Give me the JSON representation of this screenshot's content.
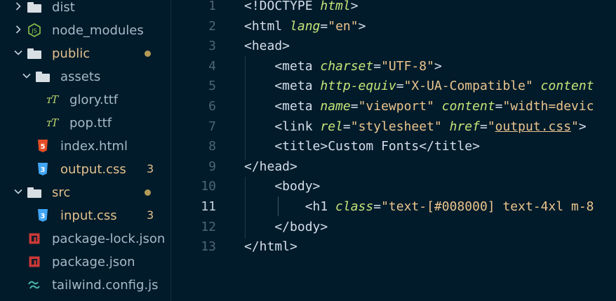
{
  "explorer": {
    "items": [
      {
        "label": "dist",
        "type": "folder",
        "expanded": false,
        "color": "#a7b9c7"
      },
      {
        "label": "node_modules",
        "type": "folder",
        "icon": "nodejs-folder-icon",
        "expanded": false,
        "color": "#a7b9c7"
      },
      {
        "label": "public",
        "type": "folder",
        "expanded": true,
        "color": "#e2c08d",
        "modified": true
      },
      {
        "label": "assets",
        "type": "folder",
        "expanded": true,
        "color": "#a7b9c7"
      },
      {
        "label": "glory.ttf",
        "type": "font",
        "color": "#a7b9c7"
      },
      {
        "label": "pop.ttf",
        "type": "font",
        "color": "#a7b9c7"
      },
      {
        "label": "index.html",
        "type": "html",
        "color": "#a7b9c7"
      },
      {
        "label": "output.css",
        "type": "css",
        "color": "#e2c08d",
        "badge": "3"
      },
      {
        "label": "src",
        "type": "folder",
        "expanded": true,
        "color": "#e2c08d",
        "modified": true
      },
      {
        "label": "input.css",
        "type": "css",
        "color": "#e2c08d",
        "badge": "3"
      },
      {
        "label": "package-lock.json",
        "type": "json",
        "color": "#a7b9c7"
      },
      {
        "label": "package.json",
        "type": "json",
        "color": "#a7b9c7"
      },
      {
        "label": "tailwind.config.js",
        "type": "tailwind",
        "color": "#a7b9c7"
      }
    ]
  },
  "editor": {
    "active_line": "11",
    "line_numbers": [
      "1",
      "2",
      "3",
      "4",
      "5",
      "6",
      "7",
      "8",
      "9",
      "10",
      "11",
      "12",
      "13"
    ],
    "lines": [
      [
        {
          "t": "<!DOCTYPE ",
          "c": "tag"
        },
        {
          "t": "html",
          "c": "attr"
        },
        {
          "t": ">",
          "c": "tag"
        }
      ],
      [
        {
          "t": "<html ",
          "c": "tag"
        },
        {
          "t": "lang",
          "c": "attr"
        },
        {
          "t": "=",
          "c": "punct"
        },
        {
          "t": "\"en\"",
          "c": "str"
        },
        {
          "t": ">",
          "c": "tag"
        }
      ],
      [
        {
          "t": "<head>",
          "c": "tag"
        }
      ],
      [
        {
          "t": "    <meta ",
          "c": "tag"
        },
        {
          "t": "charset",
          "c": "attr"
        },
        {
          "t": "=",
          "c": "punct"
        },
        {
          "t": "\"UTF-8\"",
          "c": "str"
        },
        {
          "t": ">",
          "c": "tag"
        }
      ],
      [
        {
          "t": "    <meta ",
          "c": "tag"
        },
        {
          "t": "http-equiv",
          "c": "attr"
        },
        {
          "t": "=",
          "c": "punct"
        },
        {
          "t": "\"X-UA-Compatible\" ",
          "c": "str"
        },
        {
          "t": "content",
          "c": "attr"
        }
      ],
      [
        {
          "t": "    <meta ",
          "c": "tag"
        },
        {
          "t": "name",
          "c": "attr"
        },
        {
          "t": "=",
          "c": "punct"
        },
        {
          "t": "\"viewport\" ",
          "c": "str"
        },
        {
          "t": "content",
          "c": "attr"
        },
        {
          "t": "=",
          "c": "punct"
        },
        {
          "t": "\"width=devic",
          "c": "str"
        }
      ],
      [
        {
          "t": "    <link ",
          "c": "tag"
        },
        {
          "t": "rel",
          "c": "attr"
        },
        {
          "t": "=",
          "c": "punct"
        },
        {
          "t": "\"stylesheet\" ",
          "c": "str"
        },
        {
          "t": "href",
          "c": "attr"
        },
        {
          "t": "=",
          "c": "punct"
        },
        {
          "t": "\"",
          "c": "str"
        },
        {
          "t": "output.css",
          "c": "str-u"
        },
        {
          "t": "\"",
          "c": "str"
        },
        {
          "t": ">",
          "c": "tag"
        }
      ],
      [
        {
          "t": "    <title>",
          "c": "tag"
        },
        {
          "t": "Custom Fonts",
          "c": "punct"
        },
        {
          "t": "</title>",
          "c": "tag"
        }
      ],
      [
        {
          "t": "</head>",
          "c": "tag"
        }
      ],
      [
        {
          "t": "    <body>",
          "c": "tag"
        }
      ],
      [
        {
          "t": "        <h1 ",
          "c": "tag"
        },
        {
          "t": "class",
          "c": "attr"
        },
        {
          "t": "=",
          "c": "punct"
        },
        {
          "t": "\"text-[#008000] text-4xl m-8",
          "c": "str"
        }
      ],
      [
        {
          "t": "    </body>",
          "c": "tag"
        }
      ],
      [
        {
          "t": "</html>",
          "c": "tag"
        }
      ]
    ]
  }
}
